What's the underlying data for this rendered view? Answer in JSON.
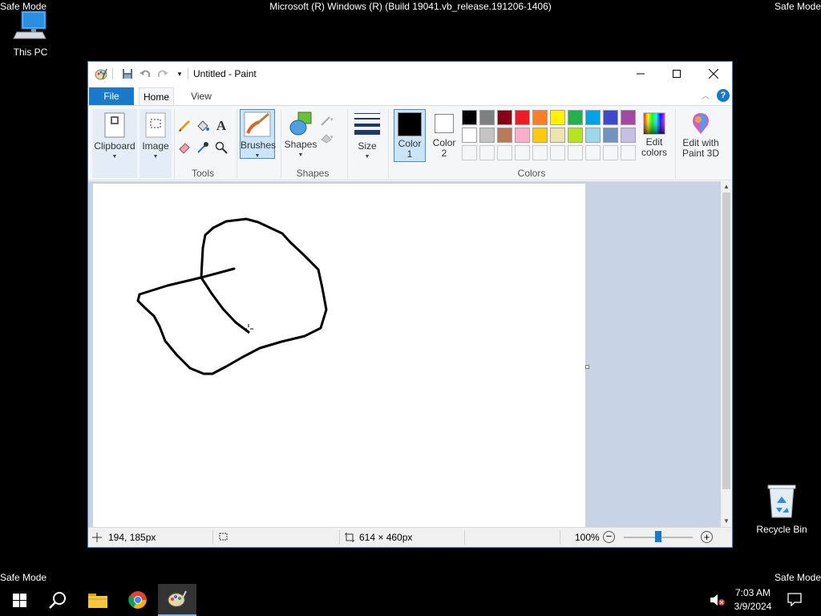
{
  "desktop": {
    "safe_mode_label": "Safe Mode",
    "build_text": "Microsoft (R) Windows (R) (Build 19041.vb_release.191206-1406)",
    "icons": [
      {
        "label": "This PC",
        "icon": "computer-icon"
      },
      {
        "label": "Recycle Bin",
        "icon": "recycle-bin-icon"
      }
    ]
  },
  "paint": {
    "window_title": "Untitled - Paint",
    "tabs": [
      {
        "label": "File"
      },
      {
        "label": "Home"
      },
      {
        "label": "View"
      }
    ],
    "ribbon": {
      "clipboard": {
        "label": "Clipboard"
      },
      "image": {
        "label": "Image"
      },
      "tools_group_label": "Tools",
      "brushes": {
        "label": "Brushes"
      },
      "shapes": {
        "label": "Shapes"
      },
      "shapes_group_label": "Shapes",
      "size": {
        "label": "Size"
      },
      "color1": {
        "line1": "Color",
        "line2": "1",
        "value": "#000000"
      },
      "color2": {
        "line1": "Color",
        "line2": "2",
        "value": "#ffffff"
      },
      "colors_group_label": "Colors",
      "edit_colors": {
        "line1": "Edit",
        "line2": "colors"
      },
      "edit_3d": {
        "line1": "Edit with",
        "line2": "Paint 3D"
      },
      "palette_row1": [
        "#000000",
        "#7f7f7f",
        "#880015",
        "#ed1c24",
        "#ff7f27",
        "#fff200",
        "#22b14c",
        "#00a2e8",
        "#3f48cc",
        "#a349a4"
      ],
      "palette_row2": [
        "#ffffff",
        "#c3c3c3",
        "#b97a57",
        "#ffaec9",
        "#ffc90e",
        "#efe4b0",
        "#b5e61d",
        "#99d9ea",
        "#7092be",
        "#c8bfe7"
      ]
    },
    "status": {
      "cursor_pos": "194, 185px",
      "canvas_size": "614 × 460px",
      "zoom": "100%"
    }
  },
  "taskbar": {
    "apps": [
      {
        "name": "start-button"
      },
      {
        "name": "search-button"
      },
      {
        "name": "file-explorer"
      },
      {
        "name": "chrome"
      },
      {
        "name": "paint"
      }
    ],
    "time": "7:03 AM",
    "date": "3/9/2024"
  }
}
